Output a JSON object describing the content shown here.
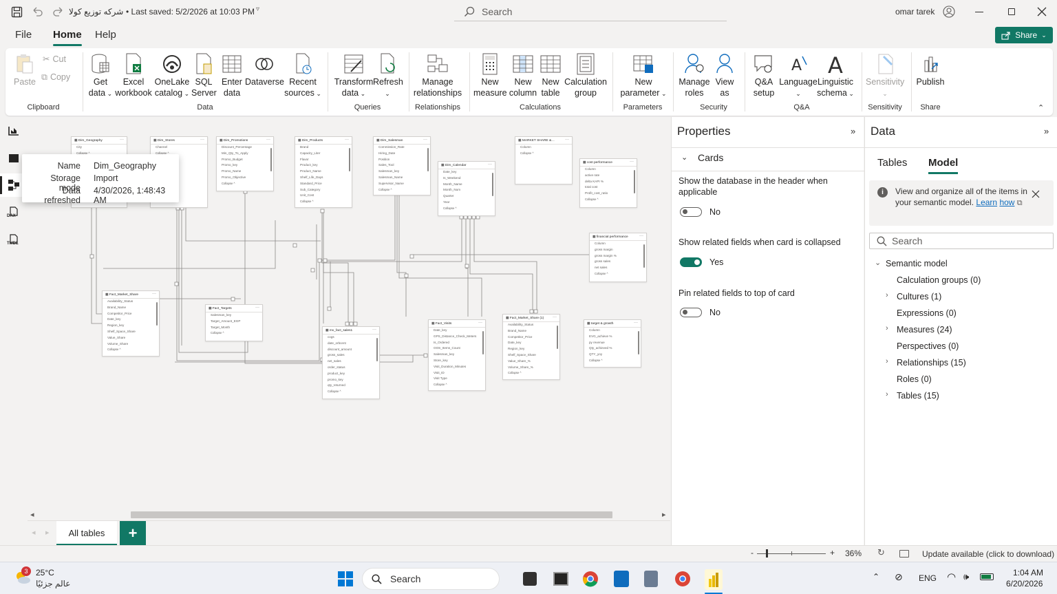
{
  "titlebar": {
    "file_name": "شركه توزيع كولا",
    "saved_text": "• Last saved: 5/2/2026 at 10:03 PM",
    "search_placeholder": "Search",
    "user": "omar tarek"
  },
  "menu": {
    "file": "File",
    "home": "Home",
    "help": "Help",
    "share": "Share"
  },
  "ribbon": {
    "paste": "Paste",
    "cut": "Cut",
    "copy": "Copy",
    "get_data": "Get data",
    "excel": "Excel workbook",
    "onelake": "OneLake catalog",
    "sql": "SQL Server",
    "enter_data": "Enter data",
    "dataverse": "Dataverse",
    "recent": "Recent sources",
    "transform": "Transform data",
    "refresh": "Refresh",
    "manage_rel": "Manage relationships",
    "new_measure": "New measure",
    "new_column": "New column",
    "new_table": "New table",
    "calc_group": "Calculation group",
    "new_param": "New parameter",
    "manage_roles": "Manage roles",
    "view_as": "View as",
    "qa_setup": "Q&A setup",
    "language": "Language",
    "ling_schema": "Linguistic schema",
    "sensitivity": "Sensitivity",
    "publish": "Publish",
    "groups": {
      "clipboard": "Clipboard",
      "data": "Data",
      "queries": "Queries",
      "relationships": "Relationships",
      "calculations": "Calculations",
      "parameters": "Parameters",
      "security": "Security",
      "qa": "Q&A",
      "sensitivity": "Sensitivity",
      "share": "Share"
    }
  },
  "rail": {
    "dax_label": "DAX",
    "tmdl_label": "TMDL"
  },
  "tables": [
    {
      "name": "Dim_Geography",
      "fields": [
        "City"
      ]
    },
    {
      "name": "Dim_Stores",
      "fields": [
        "Channel"
      ]
    },
    {
      "name": "Dim_Promotions",
      "fields": [
        "Discount_Percentage",
        "Min_Qty_To_Apply",
        "Promo_Budget",
        "Promo_key",
        "Promo_Name",
        "Promo_Objective"
      ]
    },
    {
      "name": "Dim_Products",
      "fields": [
        "Brand",
        "Capacity_Liter",
        "Flavor",
        "Product_key",
        "Product_Name",
        "Shelf_Life_Days",
        "Standard_Price",
        "Sub_Category",
        "Unit_Cost"
      ]
    },
    {
      "name": "Dim_Salesman",
      "fields": [
        "Commission_Rate",
        "Hiring_Date",
        "Position",
        "Sales_Tool",
        "Salesman_key",
        "Salesman_Name",
        "Supervisor_Name"
      ]
    },
    {
      "name": "Dim_Calendar",
      "fields": [
        "Date_key",
        "Is_Weekend",
        "Month_Name",
        "Month_Num",
        "Quarter",
        "Year"
      ]
    },
    {
      "name": "MARKET SHARE &…",
      "fields": [
        "Column"
      ]
    },
    {
      "name": "cost performance",
      "fields": [
        "Column",
        "active rate",
        "delta KAPI %",
        "total cost",
        "Profit_cost_ratio"
      ]
    },
    {
      "name": "financial performance",
      "fields": [
        "Column",
        "gross margin",
        "gross margin %",
        "gross sales",
        "net sales"
      ]
    },
    {
      "name": "Fact_Market_Share",
      "fields": [
        "Availability_Status",
        "Brand_Name",
        "Competitor_Price",
        "Date_key",
        "Region_key",
        "Shelf_Space_Share",
        "Value_Share",
        "Volume_Share"
      ]
    },
    {
      "name": "Fact_Targets",
      "fields": [
        "Salesman_key",
        "Target_Amount_EGP",
        "Target_Month"
      ]
    },
    {
      "name": "mv_fact_sales1",
      "fields": [
        "cogs",
        "date_orbcent",
        "discount_amount",
        "gross_sales",
        "net_sales",
        "order_status",
        "product_key",
        "promo_key",
        "qty_returned"
      ]
    },
    {
      "name": "Fact_Visits",
      "fields": [
        "Date_key",
        "GPS_Distance_Check_Meters",
        "Is_Ordered",
        "OOS_Items_Count",
        "Salesman_key",
        "Store_key",
        "Visit_Duration_Minutes",
        "Visit_ID",
        "Visit Type"
      ]
    },
    {
      "name": "Fact_Market_Share (1)",
      "fields": [
        "Availability_Status",
        "Brand_Name",
        "Competitor_Price",
        "Date_key",
        "Region_key",
        "Shelf_Space_Share",
        "Value_Share_%",
        "Volume_Share_%"
      ]
    },
    {
      "name": "target & growth",
      "fields": [
        "Column",
        "EVG_achieve %",
        "py revenue",
        "Qty_achieved %",
        "QTY_yoy"
      ]
    }
  ],
  "collapse_label": "Collapse ^",
  "tooltip": {
    "name_label": "Name",
    "name_value": "Dim_Geography",
    "storage_label": "Storage mode",
    "storage_value": "Import",
    "refresh_label": "Data refreshed",
    "refresh_value": "4/30/2026, 1:48:43 AM"
  },
  "tabs": {
    "all_tables": "All tables",
    "add": "+"
  },
  "properties": {
    "title": "Properties",
    "section": "Cards",
    "opt1_label": "Show the database in the header when applicable",
    "opt1_value": "No",
    "opt2_label": "Show related fields when card is collapsed",
    "opt2_value": "Yes",
    "opt3_label": "Pin related fields to top of card",
    "opt3_value": "No"
  },
  "data_pane": {
    "title": "Data",
    "tab_tables": "Tables",
    "tab_model": "Model",
    "info_text": "View and organize all of the items in your semantic model.",
    "learn": "Learn",
    "how": "how",
    "search_placeholder": "Search",
    "tree": {
      "root": "Semantic model",
      "calc_groups": "Calculation groups (0)",
      "cultures": "Cultures (1)",
      "expressions": "Expressions (0)",
      "measures": "Measures (24)",
      "perspectives": "Perspectives (0)",
      "relationships": "Relationships (15)",
      "roles": "Roles (0)",
      "tables": "Tables (15)"
    }
  },
  "status": {
    "zoom": "36%",
    "update": "Update available (click to download)",
    "zoom_minus": "-",
    "zoom_plus": "+"
  },
  "taskbar": {
    "weather_temp": "25°C",
    "weather_desc": "عالم جزئيًا",
    "weather_badge": "3",
    "search_placeholder": "Search",
    "lang": "ENG",
    "time": "1:04 AM",
    "date": "6/20/2026"
  },
  "colors": {
    "accent": "#117865",
    "canvas": "#f3f2f1",
    "panel": "#ffffff"
  }
}
